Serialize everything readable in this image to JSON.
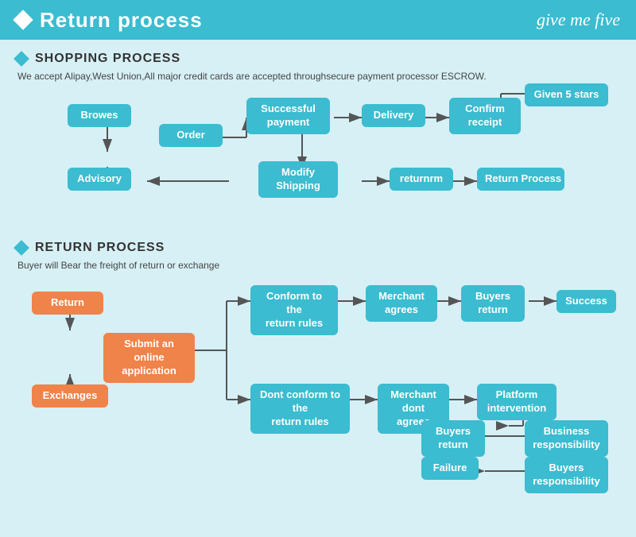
{
  "header": {
    "title": "Return process",
    "logo": "give me five"
  },
  "shopping_section": {
    "title": "SHOPPING PROCESS",
    "description": "We accept Alipay,West Union,All major credit cards are accepted throughsecure payment processor ESCROW.",
    "boxes": [
      {
        "id": "browes",
        "label": "Browes",
        "style": "teal"
      },
      {
        "id": "order",
        "label": "Order",
        "style": "teal"
      },
      {
        "id": "advisory",
        "label": "Advisory",
        "style": "teal"
      },
      {
        "id": "modify-shipping",
        "label": "Modify\nShipping",
        "style": "teal"
      },
      {
        "id": "successful-payment",
        "label": "Successful\npayment",
        "style": "teal"
      },
      {
        "id": "delivery",
        "label": "Delivery",
        "style": "teal"
      },
      {
        "id": "confirm-receipt",
        "label": "Confirm\nreceipt",
        "style": "teal"
      },
      {
        "id": "given-5-stars",
        "label": "Given 5 stars",
        "style": "teal"
      },
      {
        "id": "returnrm",
        "label": "returnrm",
        "style": "teal"
      },
      {
        "id": "return-process",
        "label": "Return Process",
        "style": "teal"
      }
    ]
  },
  "return_section": {
    "title": "RETURN PROCESS",
    "description": "Buyer will Bear the freight of return or exchange",
    "boxes": [
      {
        "id": "return",
        "label": "Return",
        "style": "orange"
      },
      {
        "id": "submit-application",
        "label": "Submit an online\napplication",
        "style": "orange"
      },
      {
        "id": "exchanges",
        "label": "Exchanges",
        "style": "orange"
      },
      {
        "id": "conform-return-rules",
        "label": "Conform to the\nreturn rules",
        "style": "teal"
      },
      {
        "id": "merchant-agrees",
        "label": "Merchant\nagrees",
        "style": "teal"
      },
      {
        "id": "buyers-return-1",
        "label": "Buyers\nreturn",
        "style": "teal"
      },
      {
        "id": "success",
        "label": "Success",
        "style": "teal"
      },
      {
        "id": "dont-conform-return-rules",
        "label": "Dont conform to the\nreturn rules",
        "style": "teal"
      },
      {
        "id": "merchant-dont-agrees",
        "label": "Merchant\ndont agrees",
        "style": "teal"
      },
      {
        "id": "platform-intervention",
        "label": "Platform\nintervention",
        "style": "teal"
      },
      {
        "id": "buyers-return-2",
        "label": "Buyers\nreturn",
        "style": "teal"
      },
      {
        "id": "business-responsibility",
        "label": "Business\nresponsibility",
        "style": "teal"
      },
      {
        "id": "failure",
        "label": "Failure",
        "style": "teal"
      },
      {
        "id": "buyers-responsibility",
        "label": "Buyers\nresponsibility",
        "style": "teal"
      }
    ]
  }
}
